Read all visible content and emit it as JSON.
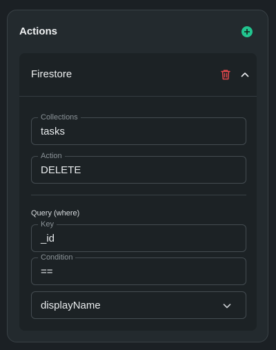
{
  "panel": {
    "title": "Actions",
    "add_icon": "plus-circle-icon"
  },
  "action_card": {
    "title": "Firestore",
    "delete_icon": "trash-icon",
    "collapse_icon": "chevron-up-icon",
    "collections": {
      "label": "Collections",
      "value": "tasks"
    },
    "action": {
      "label": "Action",
      "value": "DELETE"
    },
    "query_section_label": "Query (where)",
    "key": {
      "label": "Key",
      "value": "_id"
    },
    "condition": {
      "label": "Condition",
      "value": "=="
    },
    "field_select": {
      "value": "displayName",
      "icon": "chevron-down-icon"
    }
  },
  "colors": {
    "accent_green": "#22c48f",
    "delete_red": "#e5484d",
    "background": "#1b2024",
    "panel": "#232a2e",
    "card": "#1c2225"
  }
}
